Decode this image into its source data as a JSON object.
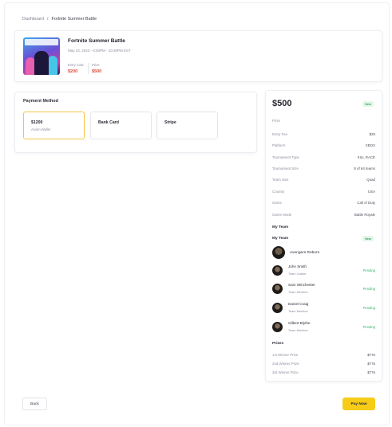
{
  "breadcrumb": {
    "root": "Dashboard",
    "separator": "/",
    "current": "Fortnite Summer Battle"
  },
  "event": {
    "title": "Fortnite Summer Battle",
    "date": "May 23, 2023 - 9:00PM - 10:30PM EST",
    "entry_cost_label": "Entry Cost",
    "entry_cost_value": "$200",
    "prize_label": "Prize",
    "prize_value": "$500"
  },
  "payment": {
    "title": "Payment Method",
    "options": [
      {
        "title": "$1200",
        "subtitle": "Axiom Wallet",
        "selected": true
      },
      {
        "title": "Bank Card",
        "subtitle": "",
        "selected": false
      },
      {
        "title": "Stripe",
        "subtitle": "",
        "selected": false
      }
    ]
  },
  "summary": {
    "price": "$500",
    "badge": "New",
    "price_label": "Prize",
    "details": [
      {
        "label": "Entry Fee",
        "value": "$25"
      },
      {
        "label": "Platform",
        "value": "XBOX"
      },
      {
        "label": "Tournament Type",
        "value": "KILL RACE"
      },
      {
        "label": "Tournament Size",
        "value": "8 of 64 teams"
      },
      {
        "label": "Team Size",
        "value": "Quad"
      },
      {
        "label": "Country",
        "value": "USA"
      },
      {
        "label": "Game",
        "value": "Call of Duty"
      },
      {
        "label": "Game Mode",
        "value": "Battle Royale"
      }
    ],
    "my_team_heading": "My Team",
    "my_team_label": "My Team",
    "my_team_badge": "New",
    "team_name": "Avengers Reborn",
    "members": [
      {
        "name": "John Smith",
        "role": "Team Leader",
        "status": "Pending"
      },
      {
        "name": "Sam Winchester",
        "role": "Team Member",
        "status": "Pending"
      },
      {
        "name": "Daniel Craig",
        "role": "Team Member",
        "status": "Pending"
      },
      {
        "name": "Gilbert Blythe",
        "role": "Team Member",
        "status": "Pending"
      }
    ],
    "prizes_heading": "Prizes",
    "prizes": [
      {
        "label": "1st Winner Prize",
        "value": "$776"
      },
      {
        "label": "2nd Winner Prize",
        "value": "$776"
      },
      {
        "label": "3rd Winner Prize",
        "value": "$776"
      }
    ]
  },
  "actions": {
    "back_label": "Back",
    "pay_label": "Pay Now"
  },
  "colors": {
    "accent": "#f7cc16",
    "price_red": "#e24b3a",
    "pending_green": "#34b36a",
    "badge_bg": "#e4f6ea"
  }
}
